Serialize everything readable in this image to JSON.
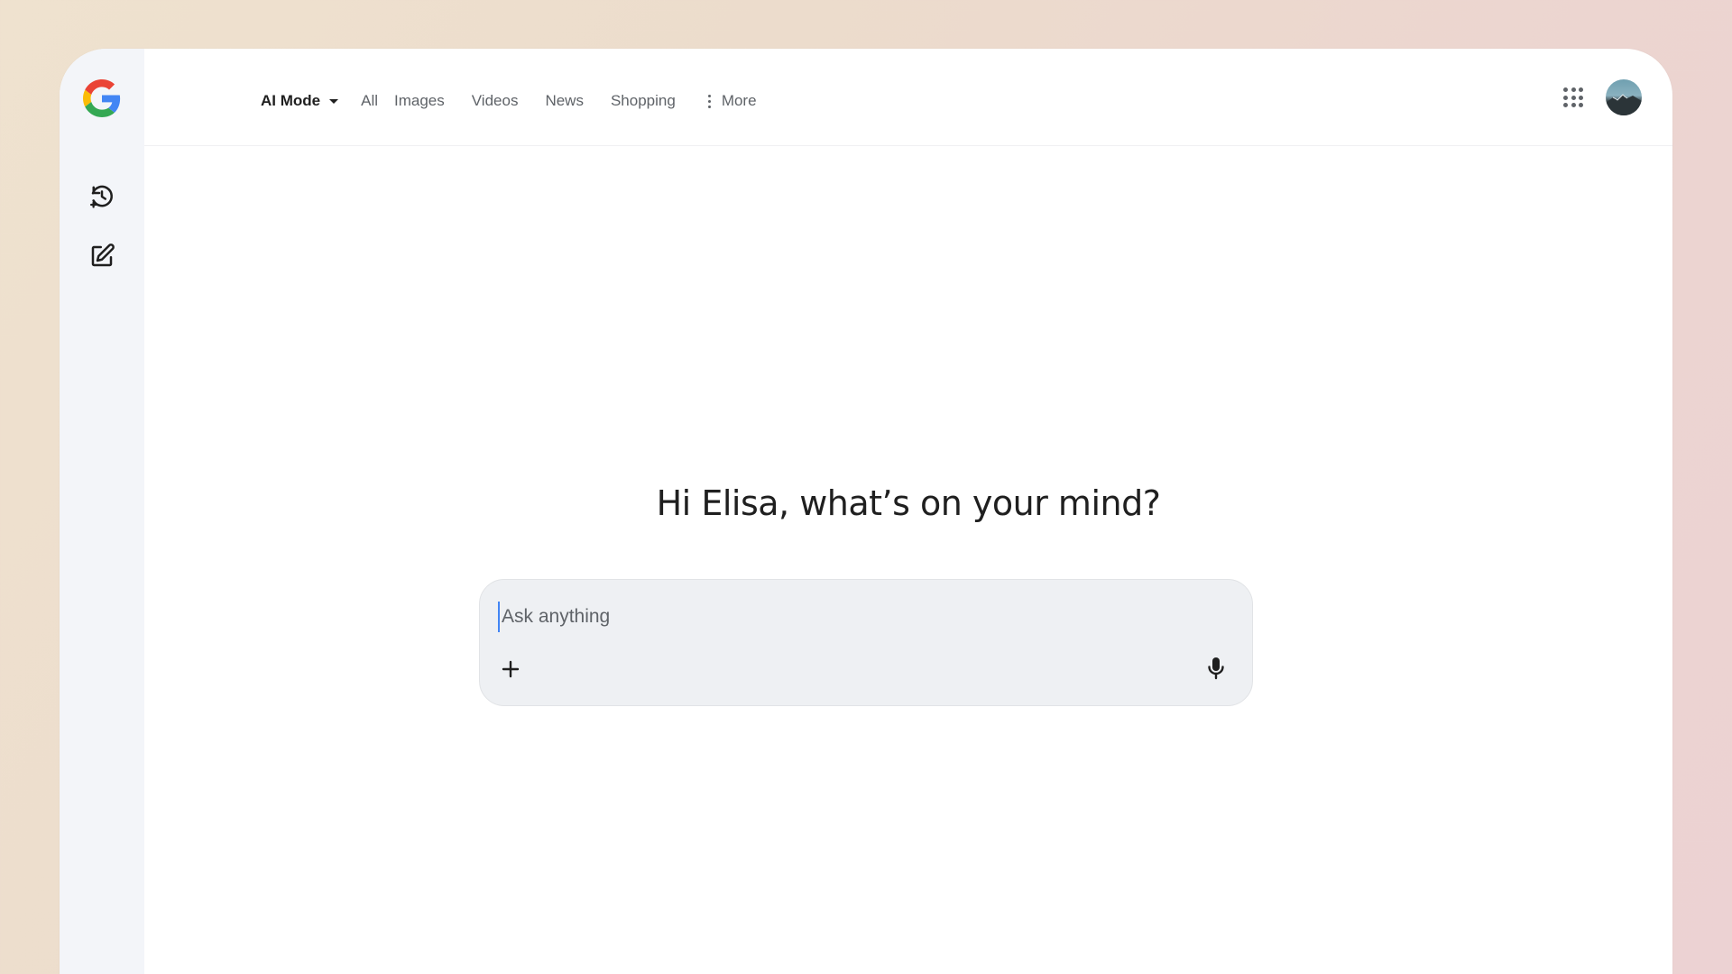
{
  "nav": {
    "tabs": [
      {
        "label": "AI Mode",
        "active": true
      },
      {
        "label": "All"
      },
      {
        "label": "Images"
      },
      {
        "label": "Videos"
      },
      {
        "label": "News"
      },
      {
        "label": "Shopping"
      },
      {
        "label": "More"
      }
    ]
  },
  "sidebar": {
    "icons": [
      "google-logo-icon",
      "history-icon",
      "new-chat-icon"
    ]
  },
  "header": {
    "icons": [
      "apps-grid-icon",
      "avatar"
    ]
  },
  "main": {
    "greeting": "Hi Elisa, what’s on your mind?",
    "search": {
      "placeholder": "Ask anything",
      "value": ""
    }
  },
  "colors": {
    "google_blue": "#4285F4",
    "google_red": "#EA4335",
    "google_yellow": "#FBBC05",
    "google_green": "#34A853",
    "text_primary": "#1f1f1f",
    "text_secondary": "#5f6368",
    "search_bg": "#eef0f3",
    "rail_bg": "#f3f5f9"
  }
}
